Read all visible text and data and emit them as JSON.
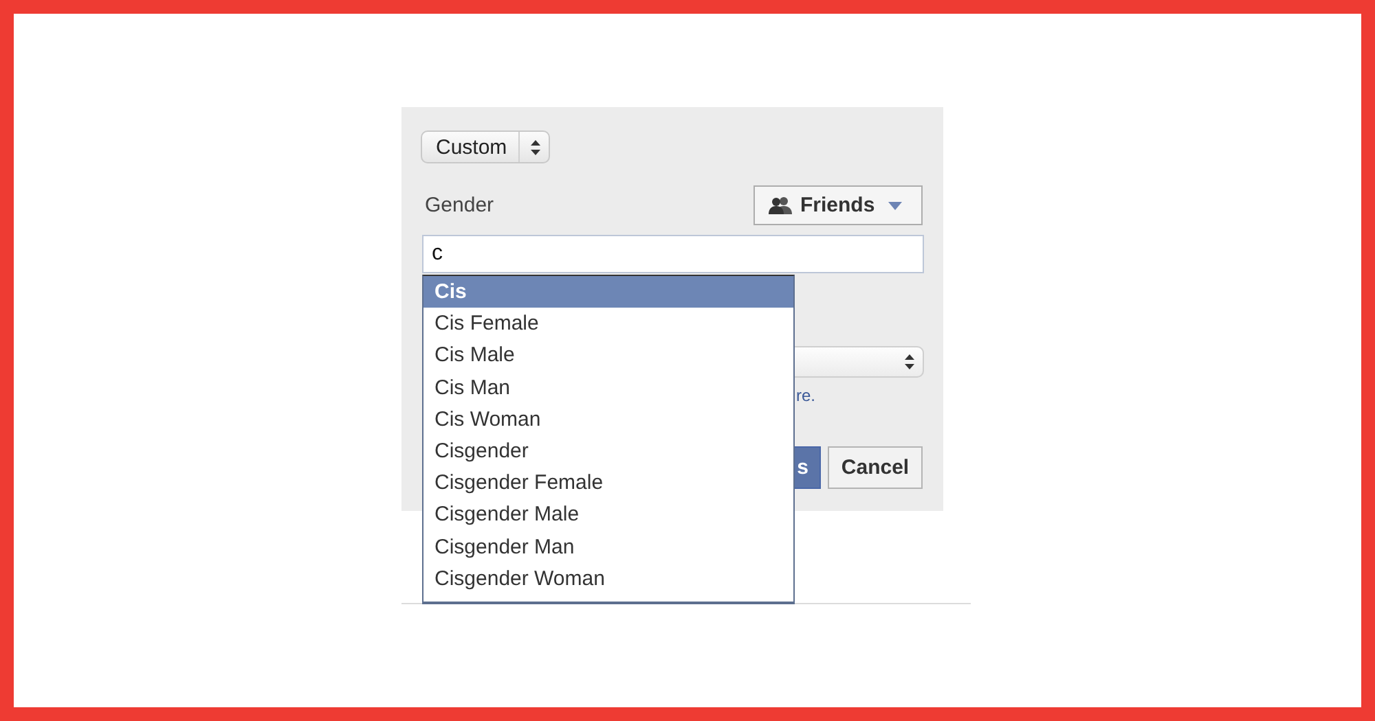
{
  "privacy_select": {
    "value": "Custom"
  },
  "field": {
    "label": "Gender",
    "audience_button": "Friends",
    "value": "c"
  },
  "suggestions": [
    {
      "label": "Cis",
      "selected": true
    },
    {
      "label": "Cis Female",
      "selected": false
    },
    {
      "label": "Cis Male",
      "selected": false
    },
    {
      "label": "Cis Man",
      "selected": false
    },
    {
      "label": "Cis Woman",
      "selected": false
    },
    {
      "label": "Cisgender",
      "selected": false
    },
    {
      "label": "Cisgender Female",
      "selected": false
    },
    {
      "label": "Cisgender Male",
      "selected": false
    },
    {
      "label": "Cisgender Man",
      "selected": false
    },
    {
      "label": "Cisgender Woman",
      "selected": false
    }
  ],
  "hint": "re.",
  "buttons": [
    {
      "kind": "primary",
      "label": "s"
    },
    {
      "kind": "secondary",
      "label": "Cancel"
    }
  ]
}
